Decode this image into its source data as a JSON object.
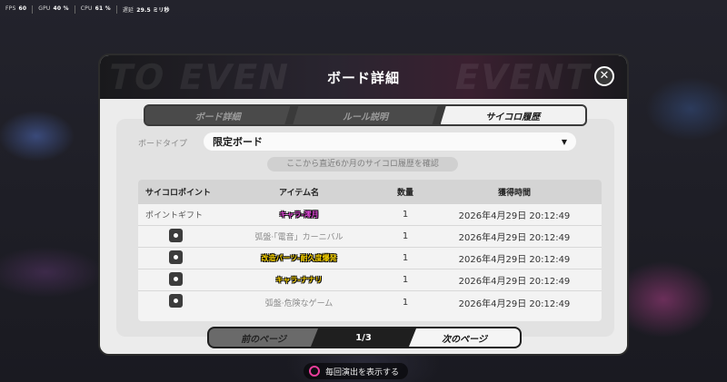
{
  "perf": {
    "fps_label": "FPS",
    "fps_value": "60",
    "gpu_label": "GPU",
    "gpu_value": "40 %",
    "cpu_label": "CPU",
    "cpu_value": "61 %",
    "latency_label": "遅延",
    "latency_value": "29.5 ミリ秒"
  },
  "modal": {
    "title": "ボード詳細",
    "header_deco_left": "TO EVEN",
    "header_deco_right": "EVENT",
    "close_icon": "close-icon"
  },
  "tabs": [
    {
      "label": "ボード詳細",
      "active": false
    },
    {
      "label": "ルール説明",
      "active": false
    },
    {
      "label": "サイコロ履歴",
      "active": true
    }
  ],
  "board_type": {
    "label": "ボードタイプ",
    "value": "限定ボード",
    "chevron": "chevron-down-icon"
  },
  "note": "ここから直近6か月のサイコロ履歴を確認",
  "table": {
    "headers": {
      "point": "サイコロポイント",
      "name": "アイテム名",
      "qty": "数量",
      "time": "獲得時間"
    },
    "rows": [
      {
        "point": "ポイントギフト",
        "point_icon": "",
        "name": "キャラ-澪月",
        "name_color": "#e048d8",
        "qty": "1",
        "time": "2026年4月29日  20:12:49"
      },
      {
        "point": "",
        "point_icon": "dice-icon",
        "name": "弧盤·「電音」カーニバル",
        "name_color": "",
        "qty": "1",
        "time": "2026年4月29日  20:12:49"
      },
      {
        "point": "",
        "point_icon": "dice-icon",
        "name": "改造パーツ-耐久度爆発",
        "name_color": "#f5d000",
        "qty": "1",
        "time": "2026年4月29日  20:12:49"
      },
      {
        "point": "",
        "point_icon": "dice-icon",
        "name": "キャラ-ナナリ",
        "name_color": "#f5d000",
        "qty": "1",
        "time": "2026年4月29日  20:12:49"
      },
      {
        "point": "",
        "point_icon": "dice-icon",
        "name": "弧盤·危険なゲーム",
        "name_color": "",
        "qty": "1",
        "time": "2026年4月29日  20:12:49"
      }
    ]
  },
  "pager": {
    "prev_label": "前のページ",
    "page": "1/3",
    "next_label": "次のページ"
  },
  "footer": {
    "label": "毎回演出を表示する"
  }
}
